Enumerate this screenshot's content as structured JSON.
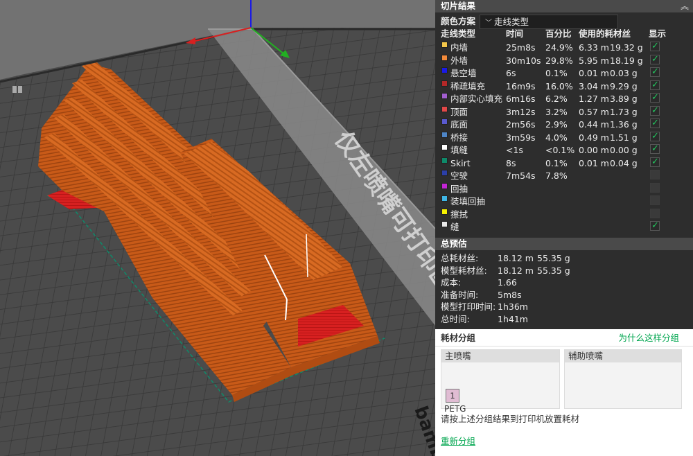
{
  "panel": {
    "title": "切片结果",
    "collapse_glyph": "︽",
    "scheme_label": "颜色方案",
    "scheme_value": "走线类型",
    "scheme_chevron": "﹀",
    "columns": [
      "走线类型",
      "时间",
      "百分比",
      "使用的耗材丝",
      "显示"
    ],
    "rows": [
      {
        "name": "内墙",
        "color": "#f3c64a",
        "time": "25m8s",
        "pct": "24.9%",
        "len": "6.33 m",
        "weight": "19.32 g",
        "shown": true
      },
      {
        "name": "外墙",
        "color": "#f28a3a",
        "time": "30m10s",
        "pct": "29.8%",
        "len": "5.95 m",
        "weight": "18.19 g",
        "shown": true
      },
      {
        "name": "悬空墙",
        "color": "#1a1ae6",
        "time": "6s",
        "pct": "0.1%",
        "len": "0.01 m",
        "weight": "0.03 g",
        "shown": true
      },
      {
        "name": "稀疏填充",
        "color": "#b42828",
        "time": "16m9s",
        "pct": "16.0%",
        "len": "3.04 m",
        "weight": "9.29 g",
        "shown": true
      },
      {
        "name": "内部实心填充",
        "color": "#a35fd0",
        "time": "6m16s",
        "pct": "6.2%",
        "len": "1.27 m",
        "weight": "3.89 g",
        "shown": true
      },
      {
        "name": "顶面",
        "color": "#e24848",
        "time": "3m12s",
        "pct": "3.2%",
        "len": "0.57 m",
        "weight": "1.73 g",
        "shown": true
      },
      {
        "name": "底面",
        "color": "#5a5ad0",
        "time": "2m56s",
        "pct": "2.9%",
        "len": "0.44 m",
        "weight": "1.36 g",
        "shown": true
      },
      {
        "name": "桥接",
        "color": "#4e86c8",
        "time": "3m59s",
        "pct": "4.0%",
        "len": "0.49 m",
        "weight": "1.51 g",
        "shown": true
      },
      {
        "name": "填缝",
        "color": "#ffffff",
        "time": "<1s",
        "pct": "<0.1%",
        "len": "0.00 m",
        "weight": "0.00 g",
        "shown": true
      },
      {
        "name": "Skirt",
        "color": "#0e8a6a",
        "time": "8s",
        "pct": "0.1%",
        "len": "0.01 m",
        "weight": "0.04 g",
        "shown": true
      },
      {
        "name": "空驶",
        "color": "#2b3fa8",
        "time": "7m54s",
        "pct": "7.8%",
        "len": "",
        "weight": "",
        "shown": false
      },
      {
        "name": "回抽",
        "color": "#c425d6",
        "time": "",
        "pct": "",
        "len": "",
        "weight": "",
        "shown": false
      },
      {
        "name": "装填回抽",
        "color": "#3fb6e6",
        "time": "",
        "pct": "",
        "len": "",
        "weight": "",
        "shown": false
      },
      {
        "name": "擦拭",
        "color": "#f5f000",
        "time": "",
        "pct": "",
        "len": "",
        "weight": "",
        "shown": false
      },
      {
        "name": "缝",
        "color": "#e8e8e8",
        "time": "",
        "pct": "",
        "len": "",
        "weight": "",
        "shown": true
      }
    ],
    "summary_title": "总预估",
    "summary": [
      {
        "label": "总耗材丝:",
        "v1": "18.12 m",
        "v2": "55.35 g"
      },
      {
        "label": "模型耗材丝:",
        "v1": "18.12 m",
        "v2": "55.35 g"
      },
      {
        "label": "成本:",
        "v1": "1.66",
        "v2": ""
      },
      {
        "label": "准备时间:",
        "v1": "5m8s",
        "v2": ""
      },
      {
        "label": "模型打印时间:",
        "v1": "1h36m",
        "v2": ""
      },
      {
        "label": "总时间:",
        "v1": "1h41m",
        "v2": ""
      }
    ]
  },
  "groups": {
    "title": "耗材分组",
    "why_link": "为什么这样分组",
    "main_nozzle": "主喷嘴",
    "aux_nozzle": "辅助喷嘴",
    "filament_slot": "1",
    "filament_type": "PETG",
    "note": "请按上述分组结果到打印机放置耗材",
    "regroup_link": "重新分组"
  },
  "viewport": {
    "plate_label": "仅左喷嘴可打印区",
    "model_color": "#d2691e",
    "accent_red": "#d72020"
  }
}
